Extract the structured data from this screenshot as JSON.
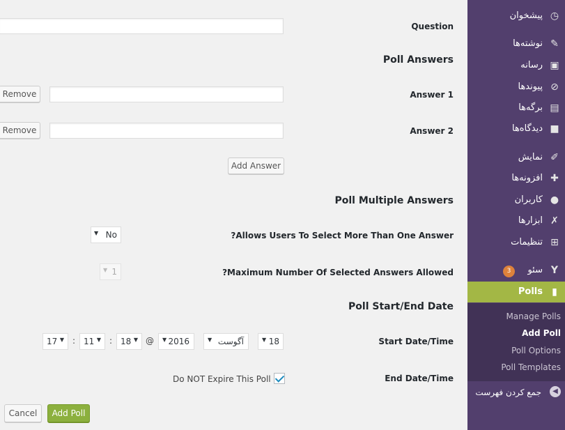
{
  "form": {
    "question_label": "Question",
    "question_value": "",
    "answers_section": "Poll Answers",
    "answers": [
      {
        "label": "Answer 1",
        "value": "",
        "remove_label": "Remove"
      },
      {
        "label": "Answer 2",
        "value": "",
        "remove_label": "Remove"
      }
    ],
    "add_answer_label": "Add Answer",
    "multiple_section": "Poll Multiple Answers",
    "allow_multiple_label": "?Allows Users To Select More Than One Answer",
    "allow_multiple_value": "No",
    "max_answers_label": "?Maximum Number Of Selected Answers Allowed",
    "max_answers_value": "1",
    "date_section": "Poll Start/End Date",
    "start_label": "Start Date/Time",
    "start": {
      "day": "18",
      "month": "آگوست",
      "year": "2016",
      "at": "@",
      "hour": "18",
      "minute": "11",
      "second": "17",
      "colon": ":"
    },
    "end_label": "End Date/Time",
    "no_expire_label": "Do NOT Expire This Poll",
    "no_expire_checked": true,
    "cancel_label": "Cancel",
    "submit_label": "Add Poll",
    "accent_color": "#8cb03e"
  },
  "sidebar": {
    "bg_color": "#523f6d",
    "active_color": "#a3b745",
    "items": [
      {
        "label": "پیشخوان",
        "icon": "dashboard-icon"
      },
      {
        "label": "نوشته‌ها",
        "icon": "pin-icon"
      },
      {
        "label": "رسانه",
        "icon": "media-icon"
      },
      {
        "label": "پیوندها",
        "icon": "link-icon"
      },
      {
        "label": "برگه‌ها",
        "icon": "pages-icon"
      },
      {
        "label": "دیدگاه‌ها",
        "icon": "comments-icon"
      },
      {
        "label": "نمایش",
        "icon": "appearance-icon"
      },
      {
        "label": "افزونه‌ها",
        "icon": "plugins-icon"
      },
      {
        "label": "کاربران",
        "icon": "users-icon"
      },
      {
        "label": "ابزارها",
        "icon": "tools-icon"
      },
      {
        "label": "تنظیمات",
        "icon": "settings-icon"
      },
      {
        "label": "سئو",
        "icon": "yoast-icon",
        "badge": "3"
      },
      {
        "label": "Polls",
        "icon": "chart-icon"
      }
    ],
    "submenu": [
      "Manage Polls",
      "Add Poll",
      "Poll Options",
      "Poll Templates"
    ],
    "collapse_label": "جمع کردن فهرست"
  }
}
